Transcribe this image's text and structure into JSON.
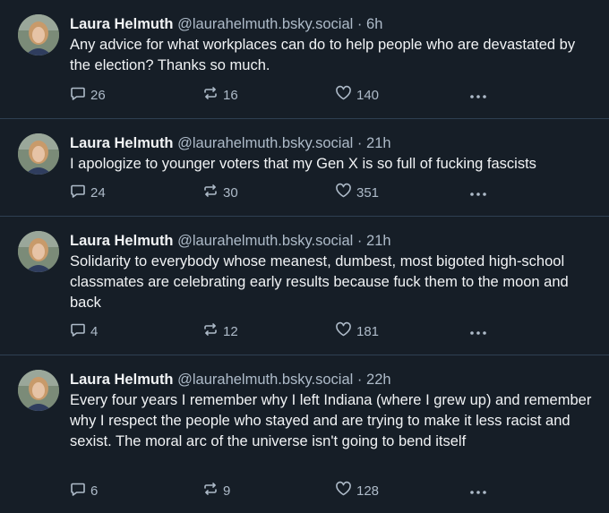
{
  "posts": [
    {
      "name": "Laura Helmuth",
      "handle": "@laurahelmuth.bsky.social",
      "separator": "·",
      "time": "6h",
      "text": "Any advice for what workplaces can do to help people who are devastated by the election? Thanks so much.",
      "replies": "26",
      "reposts": "16",
      "likes": "140"
    },
    {
      "name": "Laura Helmuth",
      "handle": "@laurahelmuth.bsky.social",
      "separator": "·",
      "time": "21h",
      "text": "I apologize to younger voters that my Gen X is so full of fucking fascists",
      "replies": "24",
      "reposts": "30",
      "likes": "351"
    },
    {
      "name": "Laura Helmuth",
      "handle": "@laurahelmuth.bsky.social",
      "separator": "·",
      "time": "21h",
      "text": "Solidarity to everybody whose meanest, dumbest, most bigoted high-school classmates are celebrating early results because fuck them to the moon and back",
      "replies": "4",
      "reposts": "12",
      "likes": "181"
    },
    {
      "name": "Laura Helmuth",
      "handle": "@laurahelmuth.bsky.social",
      "separator": "·",
      "time": "22h",
      "text": "Every four years I remember why I left Indiana (where I grew up) and remember why I respect the people who stayed and are trying to make it less racist and sexist. The moral arc of the universe isn't going to bend itself",
      "replies": "6",
      "reposts": "9",
      "likes": "128"
    }
  ],
  "icons": {
    "reply": "speech-bubble-icon",
    "repost": "repost-arrows-icon",
    "like": "heart-icon",
    "more": "more-dots-icon"
  },
  "colors": {
    "background": "#161e27",
    "divider": "#2e4052",
    "primary_text": "#f1f3f5",
    "secondary_text": "#aebbc9"
  }
}
